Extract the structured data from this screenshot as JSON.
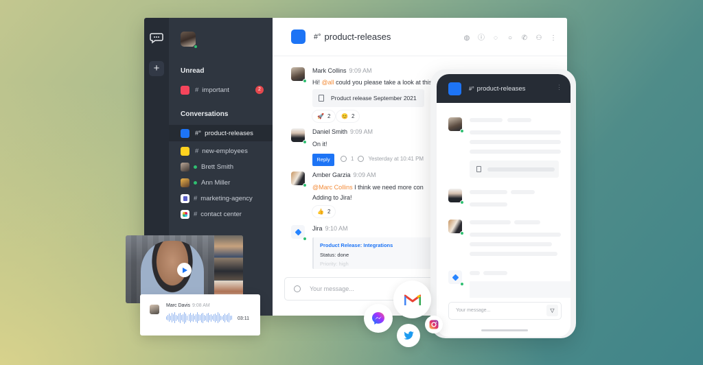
{
  "rail": {
    "logo": "chat-bubble-logo",
    "add_label": "+"
  },
  "sidebar": {
    "unread_title": "Unread",
    "unread_items": [
      {
        "label": "important",
        "prefix": "#",
        "color": "#f5455c",
        "badge": "2"
      }
    ],
    "conversations_title": "Conversations",
    "conversations": [
      {
        "label": "product-releases",
        "prefix": "#",
        "color": "#1d74f5",
        "type": "channel",
        "active": true
      },
      {
        "label": "new-employees",
        "prefix": "#",
        "color": "#ffd21f",
        "type": "channel"
      },
      {
        "label": "Brett Smith",
        "type": "dm",
        "online": true
      },
      {
        "label": "Ann Miller",
        "type": "dm",
        "online": true
      },
      {
        "label": "marketing-agency",
        "prefix": "#",
        "type": "channel",
        "icon": "teams-icon"
      },
      {
        "label": "contact center",
        "prefix": "#",
        "type": "channel",
        "icon": "slack-icon"
      }
    ]
  },
  "header": {
    "prefix": "#",
    "title": "product-releases",
    "icons": [
      "globe-icon",
      "info-icon",
      "threads-icon",
      "discussion-icon",
      "call-icon",
      "members-icon",
      "kebab-icon"
    ]
  },
  "messages": [
    {
      "author": "Mark Collins",
      "time": "9:09 AM",
      "text_before": "Hi! ",
      "mention": "@all",
      "text_after": " could you please take a look at this",
      "attachment": "Product release September 2021",
      "reactions": [
        {
          "emoji": "🚀",
          "count": "2"
        },
        {
          "emoji": "😊",
          "count": "2"
        }
      ]
    },
    {
      "author": "Daniel Smith",
      "time": "9:09 AM",
      "text": "On it!",
      "reply_label": "Reply",
      "reply_count": "1",
      "last_reply": "Yesterday at 10:41 PM"
    },
    {
      "author": "Amber Garzia",
      "time": "9:09 AM",
      "mention": "@Marc Collins",
      "text_after": " I think we need more con",
      "text_line2": "Adding to Jira!",
      "reactions": [
        {
          "emoji": "👍",
          "count": "2"
        }
      ]
    },
    {
      "author": "Jira",
      "time": "9:10 AM",
      "card_title": "Product Release: Integrations",
      "card_status": "Status: done",
      "card_priority": "Priority: high"
    }
  ],
  "composer": {
    "placeholder": "Your message..."
  },
  "phone": {
    "prefix": "#",
    "title": "product-releases",
    "composer_placeholder": "Your message..."
  },
  "voice_message": {
    "author": "Marc Davis",
    "time": "9:08 AM",
    "duration": "03:11"
  },
  "socials": [
    "gmail-icon",
    "messenger-icon",
    "twitter-icon",
    "instagram-icon"
  ]
}
